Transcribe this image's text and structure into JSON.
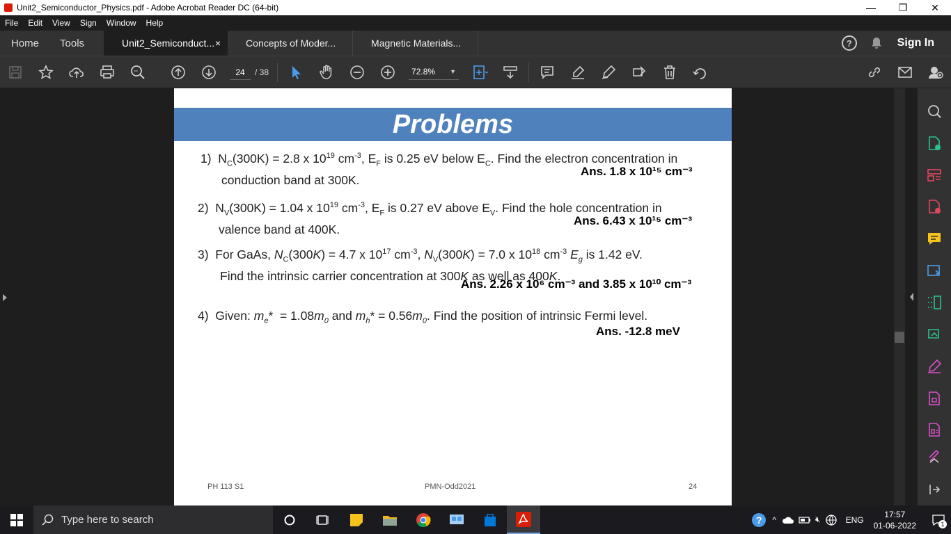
{
  "window": {
    "title": "Unit2_Semiconductor_Physics.pdf - Adobe Acrobat Reader DC (64-bit)",
    "minimize": "—",
    "maximize": "❐",
    "close": "✕"
  },
  "menu": [
    "File",
    "Edit",
    "View",
    "Sign",
    "Window",
    "Help"
  ],
  "tabs": {
    "home": "Home",
    "tools": "Tools",
    "docs": [
      {
        "label": "Unit2_Semiconduct...",
        "close": "×",
        "active": true
      },
      {
        "label": "Concepts of Moder...",
        "active": false
      },
      {
        "label": "Magnetic Materials...",
        "active": false
      }
    ],
    "help": "?",
    "sign_in": "Sign In"
  },
  "toolbar": {
    "current_page": "24",
    "total_pages": "/ 38",
    "zoom": "72.8%"
  },
  "page": {
    "heading": "Problems",
    "problems": [
      {
        "num": "1)",
        "answer": "Ans. 1.8 x 10¹⁵ cm⁻³"
      },
      {
        "num": "2)",
        "answer": "Ans. 6.43 x 10¹⁵ cm⁻³"
      },
      {
        "num": "3)",
        "answer": "Ans. 2.26 x 10⁶ cm⁻³ and  3.85 x 10¹⁰ cm⁻³"
      },
      {
        "num": "4)",
        "answer": "Ans.   -12.8 meV"
      }
    ],
    "footer_left": "PH 113 S1",
    "footer_center": "PMN-Odd2021",
    "footer_right": "24"
  },
  "taskbar": {
    "search_placeholder": "Type here to search",
    "language": "ENG",
    "time": "17:57",
    "date": "01-06-2022",
    "notification_count": "1"
  },
  "colors": {
    "banner": "#4f81bd",
    "acrobat_red": "#d81e05"
  }
}
